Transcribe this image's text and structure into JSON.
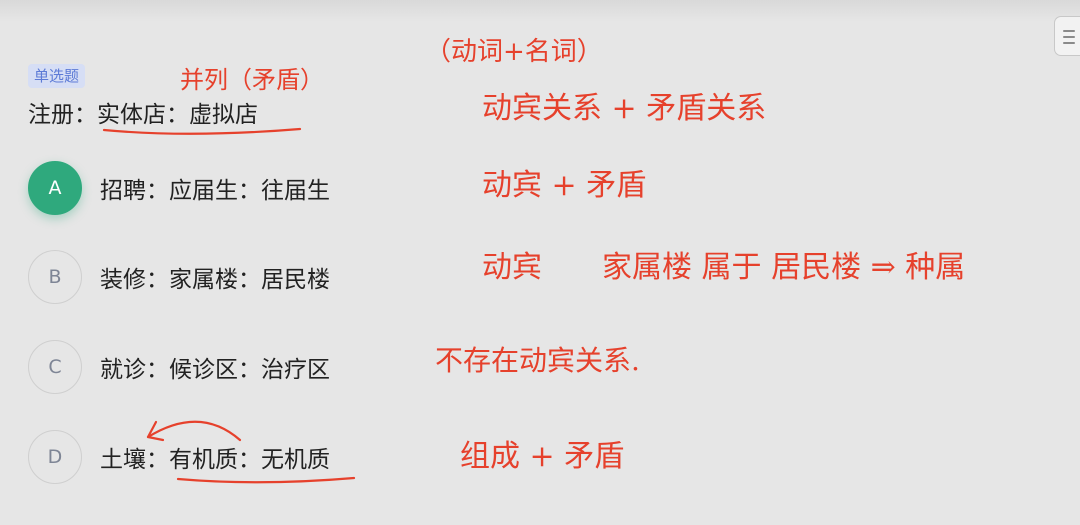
{
  "question": {
    "type_badge": "单选题",
    "stem": "注册：实体店：虚拟店"
  },
  "options": [
    {
      "letter": "A",
      "text": "招聘：应届生：往届生",
      "selected": true
    },
    {
      "letter": "B",
      "text": "装修：家属楼：居民楼",
      "selected": false
    },
    {
      "letter": "C",
      "text": "就诊：候诊区：治疗区",
      "selected": false
    },
    {
      "letter": "D",
      "text": "土壤：有机质：无机质",
      "selected": false
    }
  ],
  "annotations": {
    "stem_relation": "并列（矛盾）",
    "header_note": "（动词+名词）",
    "stem_note": "动宾关系 + 矛盾关系",
    "option_a_note": "动宾 + 矛盾",
    "option_b_note": "动宾　　家属楼 属于 居民楼 ⇒ 种属",
    "option_c_note": "不存在动宾关系.",
    "option_d_note": "组成 + 矛盾"
  },
  "colors": {
    "selected_green": "#2fa97d",
    "badge_bg": "#d6def5",
    "badge_text": "#5d7bd6",
    "ink_red": "#e6412c"
  }
}
